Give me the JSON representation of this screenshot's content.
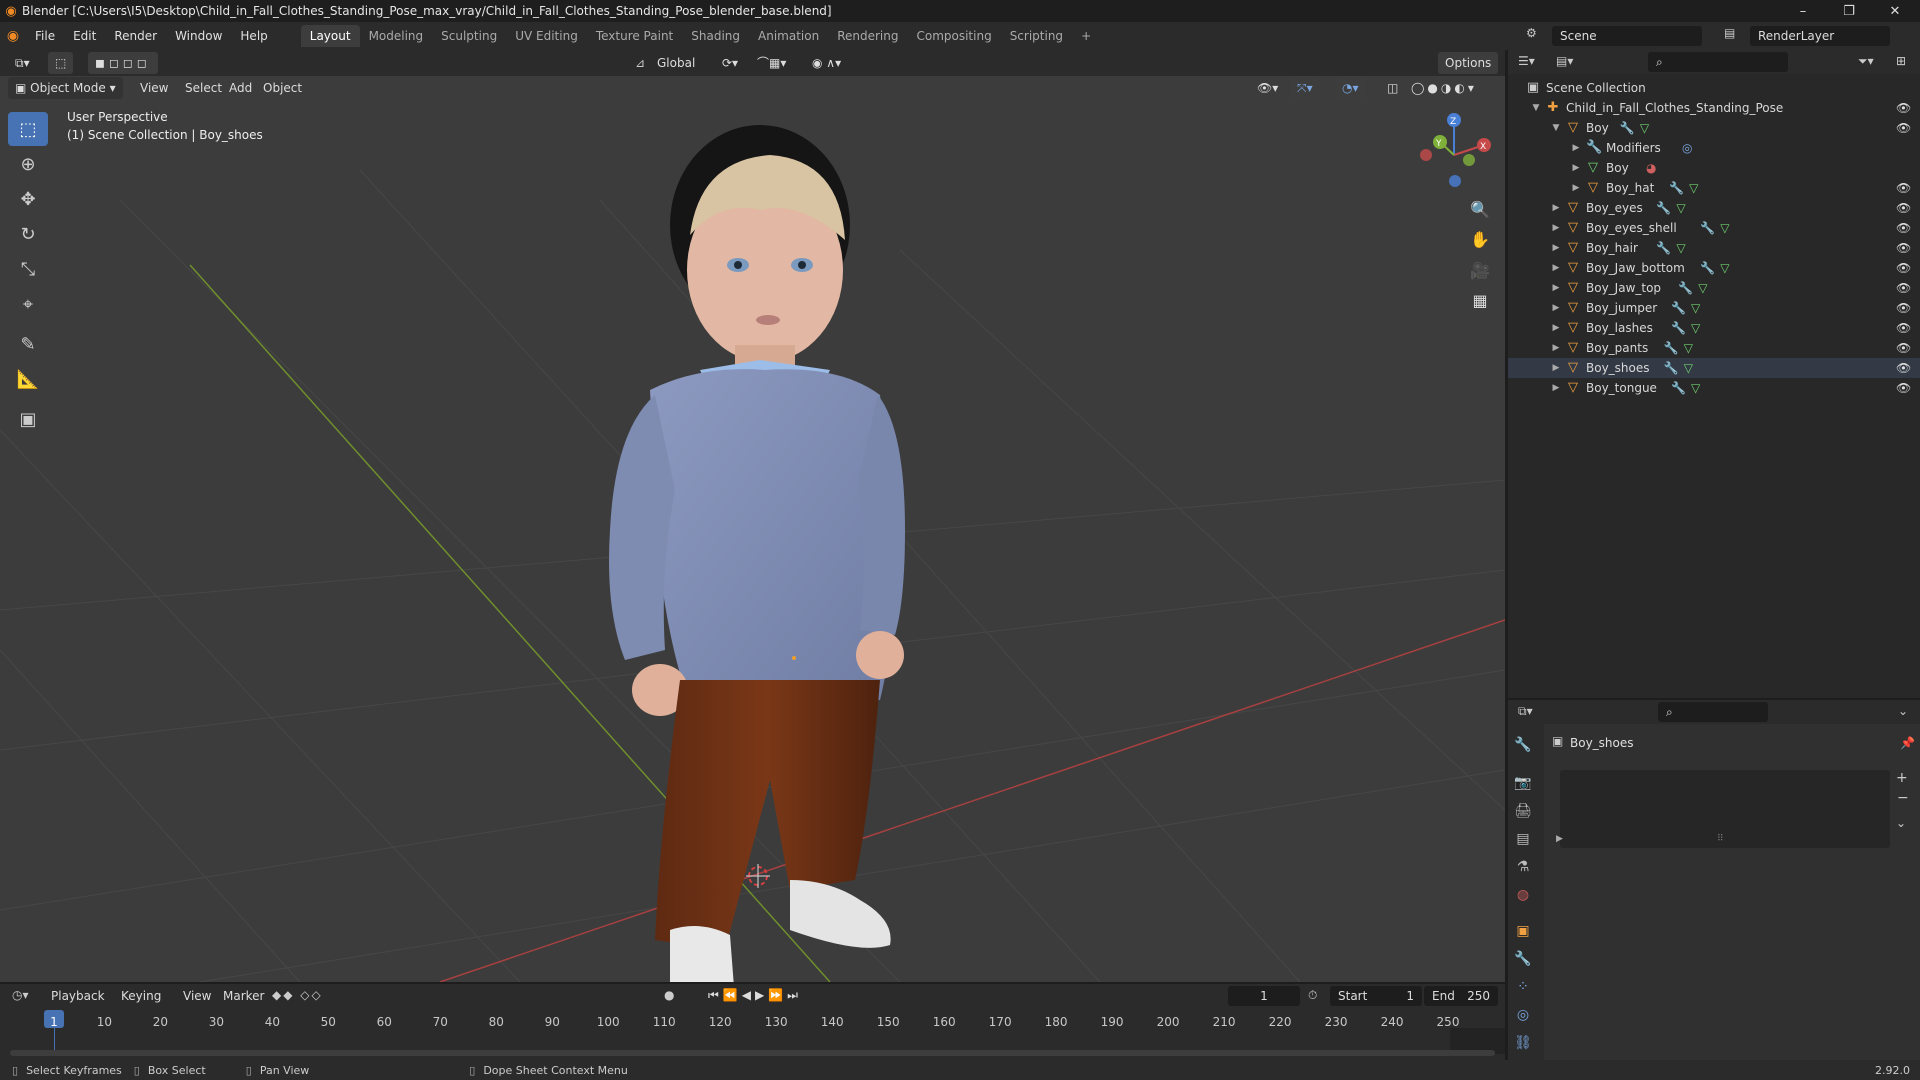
{
  "window": {
    "title": "Blender [C:\\Users\\I5\\Desktop\\Child_in_Fall_Clothes_Standing_Pose_max_vray/Child_in_Fall_Clothes_Standing_Pose_blender_base.blend]",
    "minimize": "–",
    "restore": "❐",
    "close": "✕"
  },
  "menu": [
    "File",
    "Edit",
    "Render",
    "Window",
    "Help"
  ],
  "workspaces": [
    "Layout",
    "Modeling",
    "Sculpting",
    "UV Editing",
    "Texture Paint",
    "Shading",
    "Animation",
    "Rendering",
    "Compositing",
    "Scripting"
  ],
  "workspace_add": "+",
  "scene": {
    "name": "Scene",
    "view_layer": "RenderLayer"
  },
  "viewport": {
    "mode": "Object Mode",
    "menus": [
      "View",
      "Select",
      "Add",
      "Object"
    ],
    "transform_orientation": "Global",
    "options_label": "Options",
    "overlay_title": "User Perspective",
    "overlay_subtitle": "(1) Scene Collection | Boy_shoes",
    "gizmo": {
      "x": "X",
      "y": "Y",
      "z": "Z"
    }
  },
  "outliner": {
    "root": "Scene Collection",
    "items": [
      {
        "label": "Child_in_Fall_Clothes_Standing_Pose",
        "depth": 1,
        "expanded": true,
        "icon": "armature-icon"
      },
      {
        "label": "Boy",
        "depth": 2,
        "expanded": true,
        "icon": "object-icon"
      },
      {
        "label": "Modifiers",
        "depth": 3,
        "expanded": false,
        "icon": "wrench-icon"
      },
      {
        "label": "Boy",
        "depth": 3,
        "expanded": false,
        "icon": "mesh-icon"
      },
      {
        "label": "Boy_hat",
        "depth": 3,
        "expanded": false,
        "icon": "object-icon"
      },
      {
        "label": "Boy_eyes",
        "depth": 2,
        "expanded": false,
        "icon": "object-icon"
      },
      {
        "label": "Boy_eyes_shell",
        "depth": 2,
        "expanded": false,
        "icon": "object-icon"
      },
      {
        "label": "Boy_hair",
        "depth": 2,
        "expanded": false,
        "icon": "object-icon"
      },
      {
        "label": "Boy_Jaw_bottom",
        "depth": 2,
        "expanded": false,
        "icon": "object-icon"
      },
      {
        "label": "Boy_Jaw_top",
        "depth": 2,
        "expanded": false,
        "icon": "object-icon"
      },
      {
        "label": "Boy_jumper",
        "depth": 2,
        "expanded": false,
        "icon": "object-icon"
      },
      {
        "label": "Boy_lashes",
        "depth": 2,
        "expanded": false,
        "icon": "object-icon"
      },
      {
        "label": "Boy_pants",
        "depth": 2,
        "expanded": false,
        "icon": "object-icon"
      },
      {
        "label": "Boy_shoes",
        "depth": 2,
        "expanded": false,
        "icon": "object-icon"
      },
      {
        "label": "Boy_tongue",
        "depth": 2,
        "expanded": false,
        "icon": "object-icon"
      }
    ]
  },
  "properties": {
    "object_name": "Boy_shoes"
  },
  "timeline": {
    "menus": [
      "Playback",
      "Keying",
      "View",
      "Marker"
    ],
    "current_frame": "1",
    "start_label": "Start",
    "start": "1",
    "end_label": "End",
    "end": "250",
    "ticks": [
      "1",
      "10",
      "20",
      "30",
      "40",
      "50",
      "60",
      "70",
      "80",
      "90",
      "100",
      "110",
      "120",
      "130",
      "140",
      "150",
      "160",
      "170",
      "180",
      "190",
      "200",
      "210",
      "220",
      "230",
      "240",
      "250"
    ]
  },
  "status": {
    "items": [
      "Select Keyframes",
      "Box Select",
      "Pan View",
      "Dope Sheet Context Menu"
    ],
    "version": "2.92.0"
  },
  "colors": {
    "accent": "#4772b3",
    "viewport_bg": "#3c3c3c",
    "x_axis": "#c64a4a",
    "y_axis": "#7fb03a"
  }
}
